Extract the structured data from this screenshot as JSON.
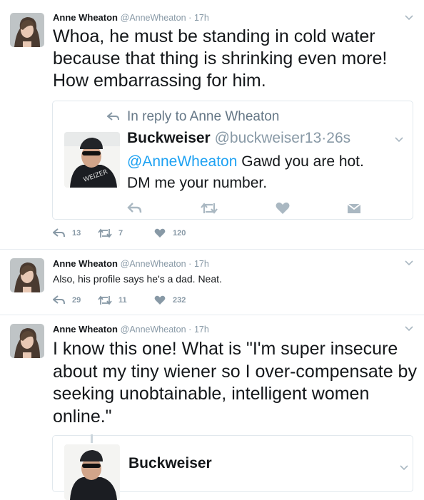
{
  "tweets": [
    {
      "author": "Anne Wheaton",
      "handle": "@AnneWheaton",
      "dot": "·",
      "time": "17h",
      "text": "Whoa, he must be standing in cold water because that thing is shrinking even more! How embarrassing for him.",
      "replies": "13",
      "retweets": "7",
      "likes": "120"
    },
    {
      "author": "Anne Wheaton",
      "handle": "@AnneWheaton",
      "dot": "·",
      "time": "17h",
      "text": "Also, his profile says he's a dad. Neat.",
      "replies": "29",
      "retweets": "11",
      "likes": "232"
    },
    {
      "author": "Anne Wheaton",
      "handle": "@AnneWheaton",
      "dot": "·",
      "time": "17h",
      "text": "I know this one! What is \"I'm super insecure about my tiny wiener so I over-compensate by seeking unobtainable, intelligent women online.\""
    }
  ],
  "quote1": {
    "reply_context": "In reply to Anne Wheaton",
    "author": "Buckweiser",
    "handle": "@buckweiser13",
    "dot": "·",
    "time": "26s",
    "mention": "@AnneWheaton",
    "text_line1": " Gawd you are hot.",
    "text_line2": "DM me your number."
  },
  "quote2": {
    "author": "Buckweiser"
  },
  "colors": {
    "link": "#1da1f2",
    "muted": "#8899a6",
    "text": "#14171a",
    "border": "#e6ecf0"
  }
}
